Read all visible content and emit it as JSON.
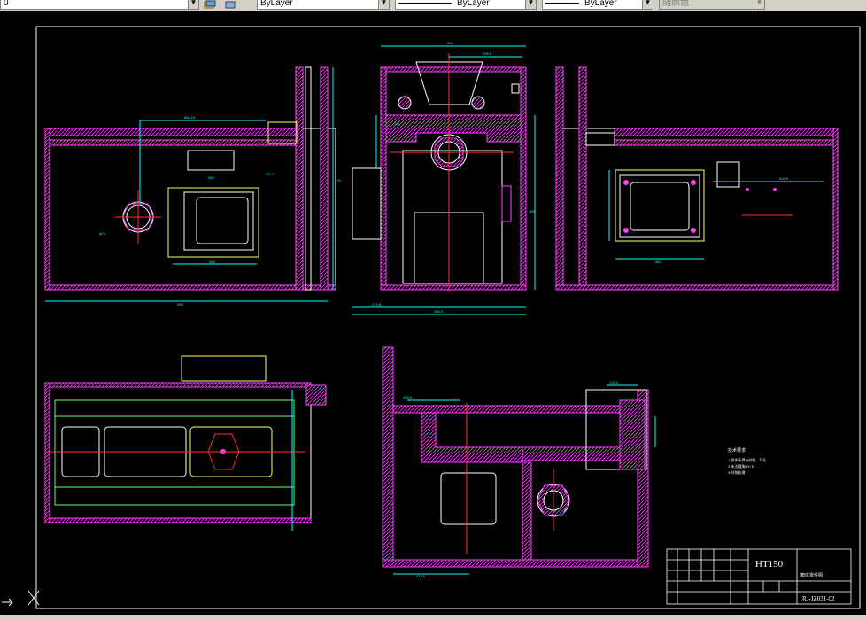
{
  "toolbar": {
    "layer_value": "0",
    "color_value": "ByLayer",
    "linetype_value": "ByLayer",
    "lineweight_value": "ByLayer",
    "plotstyle_value": "随颜色"
  },
  "drawing": {
    "material": "HT150",
    "drawing_number": "RJ-JZ031-02",
    "part_name": "箱体零件图",
    "notes_title": "技术要求",
    "notes": [
      "1.铸件不得有砂眼、气孔",
      "2.未注圆角R3~5",
      "3.时效处理"
    ]
  },
  "dimensions": {
    "front_overall_width": "956",
    "front_top_span": "854.10",
    "front_offset": "301.5",
    "front_hole": "φ74",
    "front_window": "585",
    "front_window2": "548",
    "front_height": "476",
    "side_width": "454",
    "side_top": "235.5",
    "side_left": "110",
    "side_bottom": "274.8",
    "side_total": "356.9",
    "side_height": "456",
    "right_dim1": "584",
    "right_dim2": "628.5",
    "bottom_dim1": "436.5",
    "bottom_dim2": "272.5",
    "bottom_dim3": "176.4"
  },
  "colors": {
    "hatch": "#ff40ff",
    "outline": "#ffffff",
    "dimension": "#00ffff",
    "centerline": "#ff3030",
    "green_lines": "#60ff60",
    "yellow": "#ffff60",
    "title_grid": "#ffffff"
  },
  "icons": {
    "ucs": "ucs-axis-icon",
    "layer_states": "layer-stack-icon"
  }
}
